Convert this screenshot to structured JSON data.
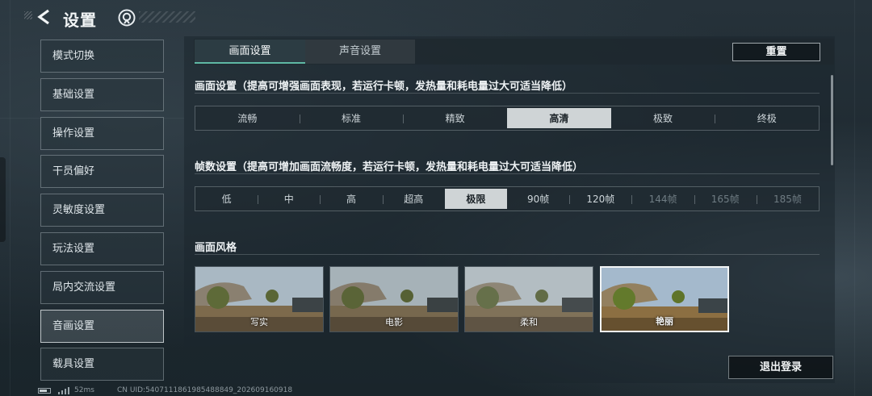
{
  "header": {
    "title": "设置",
    "back_icon": "chevron-left-icon",
    "logo_icon": "app-logo-icon"
  },
  "sidebar": {
    "items": [
      {
        "label": "模式切换"
      },
      {
        "label": "基础设置"
      },
      {
        "label": "操作设置"
      },
      {
        "label": "干员偏好"
      },
      {
        "label": "灵敏度设置"
      },
      {
        "label": "玩法设置"
      },
      {
        "label": "局内交流设置"
      },
      {
        "label": "音画设置",
        "active": true
      },
      {
        "label": "载具设置"
      }
    ]
  },
  "tabs": [
    {
      "label": "画面设置",
      "active": true
    },
    {
      "label": "声音设置",
      "active": false
    }
  ],
  "reset_label": "重置",
  "quality": {
    "title": "画面设置（提高可增强画面表现，若运行卡顿，发热量和耗电量过大可适当降低）",
    "options": [
      "流畅",
      "标准",
      "精致",
      "高清",
      "极致",
      "终极"
    ],
    "selected": "高清"
  },
  "framerate": {
    "title": "帧数设置（提高可增加画面流畅度，若运行卡顿，发热量和耗电量过大可适当降低）",
    "options": [
      "低",
      "中",
      "高",
      "超高",
      "极限",
      "90帧",
      "120帧",
      "144帧",
      "165帧",
      "185帧"
    ],
    "disabled": [
      "144帧",
      "165帧",
      "185帧"
    ],
    "selected": "极限"
  },
  "style": {
    "title": "画面风格",
    "options": [
      "写实",
      "电影",
      "柔和",
      "艳丽"
    ],
    "selected": "艳丽"
  },
  "logout_label": "退出登录",
  "status": {
    "ping": "52ms",
    "uid": "CN UID:5407111861985488849_202609160918"
  },
  "colors": {
    "accent": "#5fb8a4",
    "selected_bg": "#cfd4d6"
  }
}
